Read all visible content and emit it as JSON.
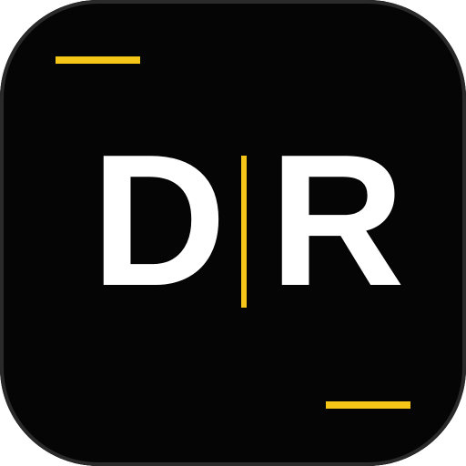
{
  "icon": {
    "name": "DR app icon",
    "letters": {
      "left": "D",
      "right": "R"
    },
    "colors": {
      "background": "#050505",
      "text": "#ffffff",
      "accent": "#f5c518",
      "border": "#2a2a2a"
    }
  }
}
